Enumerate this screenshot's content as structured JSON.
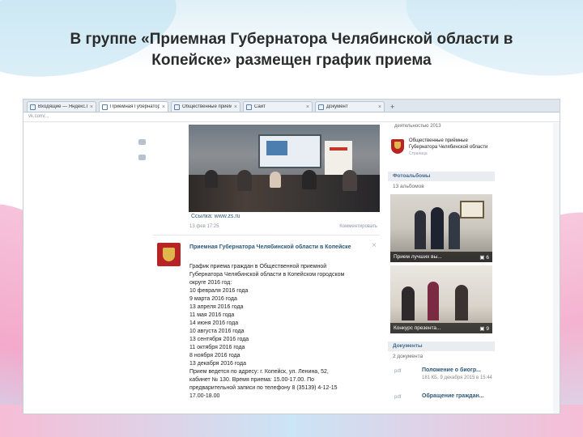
{
  "slide": {
    "title_line1": "В группе «Приемная Губернатора Челябинской области в",
    "title_line2": "Копейске» размещен график приема"
  },
  "browser": {
    "tabs": [
      {
        "label": "Входящие — Яндекс.Почта",
        "active": false
      },
      {
        "label": "Приемная Губернатора Че",
        "active": true
      },
      {
        "label": "Общественные приемн",
        "active": false
      },
      {
        "label": "Сайт",
        "active": false
      },
      {
        "label": "Документ",
        "active": false
      }
    ],
    "new_tab": "+",
    "close_glyph": "×",
    "address": "vk.com/..."
  },
  "post1": {
    "source": "Ссылка: www.zs.ru",
    "date": "13 фев 17:25",
    "comment": "Комментировать"
  },
  "post2": {
    "author": "Приемная Губернатора Челябинской области в Копейске",
    "close": "×",
    "lines": [
      "График приема граждан в Общественной приемной",
      "Губернатора Челябинской области в Копейском городском",
      "округе 2016 год:",
      "10 февраля 2016 года",
      "9 марта 2016 года",
      "13 апреля 2016 года",
      "11 мая 2016 года",
      "14 июня 2016 года",
      "10 августа 2016 года",
      "13 сентября 2016 года",
      "11 октября 2016 года",
      "8 ноября 2016 года",
      "13 декабря 2016 года",
      "Прием ведется по адресу: г. Копейск, ул. Ленина, 52,",
      "кабинет № 130. Время приема: 15.00-17.00. По",
      "предварительной записи по телефону 8 (35139) 4-12-15",
      "17.00-18.00"
    ]
  },
  "right_column": {
    "top_text": "деятельностью 2013",
    "public_title": "Общественные приёмные Губернатора Челябинской области",
    "public_sub": "Страница",
    "photo_header": "Фотоальбомы",
    "photo_count": "13 альбомов",
    "albums": [
      {
        "title": "Прием лучших вы...",
        "count": "6"
      },
      {
        "title": "Конкурс презента...",
        "count": "9"
      }
    ],
    "docs_header": "Документы",
    "docs_count": "2 документа",
    "docs": [
      {
        "ext": "pdf",
        "title": "Положение о биогр...",
        "meta": "181 КБ, 9 декабря 2015 в 15:44"
      },
      {
        "ext": "pdf",
        "title": "Обращение граждан...",
        "meta": ""
      }
    ]
  },
  "colors": {
    "link": "#2b587a",
    "vk_header": "#45688e",
    "crest_red": "#b82323",
    "crest_gold": "#e0b74a"
  }
}
